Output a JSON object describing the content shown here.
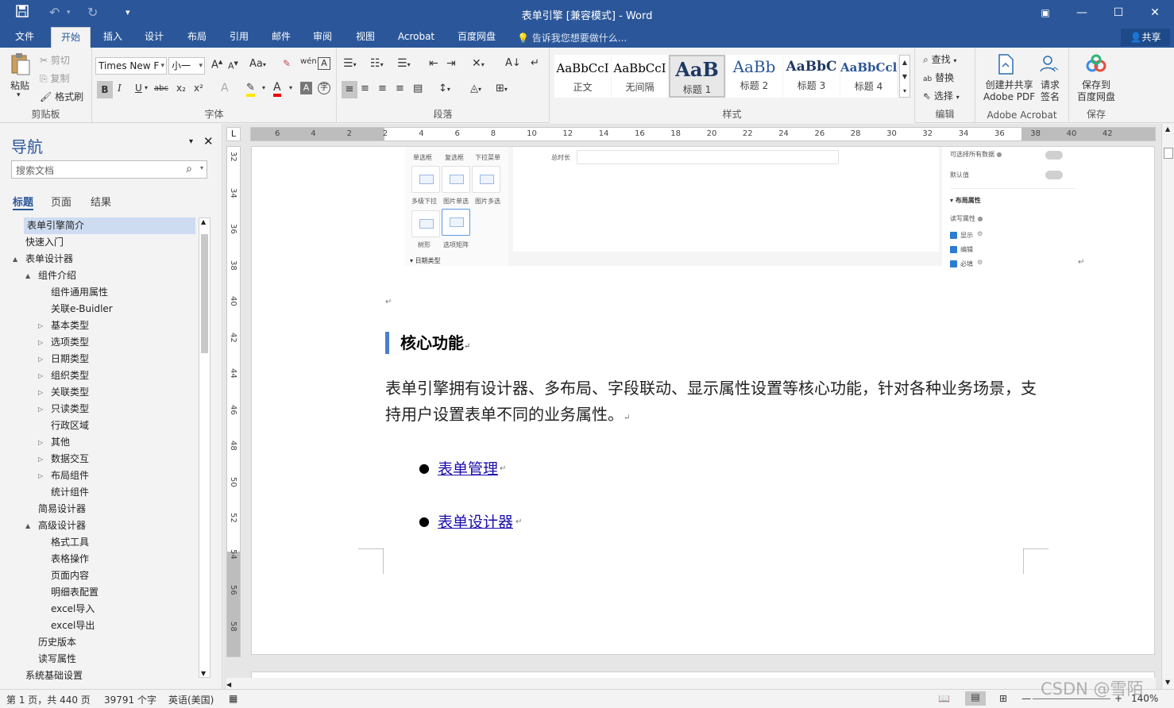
{
  "window": {
    "title": "表单引擎  [兼容模式] - Word"
  },
  "quick_access": {
    "save_icon": "save-icon",
    "undo_icon": "undo-icon",
    "redo_icon": "redo-icon",
    "customize_icon": "customize-icon"
  },
  "tabs": [
    "文件",
    "开始",
    "插入",
    "设计",
    "布局",
    "引用",
    "邮件",
    "审阅",
    "视图",
    "Acrobat",
    "百度网盘"
  ],
  "active_tab": "开始",
  "tell_me": "告诉我您想要做什么...",
  "share": "共享",
  "clipboard": {
    "paste": "粘贴",
    "cut": "剪切",
    "copy": "复制",
    "format_painter": "格式刷",
    "label": "剪贴板"
  },
  "font": {
    "name": "Times New F",
    "size": "小一",
    "label": "字体",
    "case": "Aa",
    "wen": "wén",
    "bold": "B",
    "italic": "I",
    "underline": "U",
    "strike": "abc",
    "sub": "x₂",
    "sup": "x²"
  },
  "paragraph": {
    "label": "段落"
  },
  "styles": {
    "label": "样式",
    "items": [
      {
        "preview": "AaBbCcI",
        "name": "正文"
      },
      {
        "preview": "AaBbCcI",
        "name": "无间隔"
      },
      {
        "preview": "AaB",
        "name": "标题 1"
      },
      {
        "preview": "AaBb",
        "name": "标题 2"
      },
      {
        "preview": "AaBbC",
        "name": "标题 3"
      },
      {
        "preview": "AaBbCcl",
        "name": "标题 4"
      }
    ]
  },
  "editing": {
    "find": "查找",
    "replace": "替换",
    "select": "选择",
    "label": "编辑"
  },
  "acrobat": {
    "create": "创建并共享",
    "create2": "Adobe PDF",
    "request": "请求",
    "request2": "签名",
    "label": "Adobe Acrobat"
  },
  "save_group": {
    "save": "保存到",
    "save2": "百度网盘",
    "label": "保存"
  },
  "nav": {
    "title": "导航",
    "search_placeholder": "搜索文档",
    "tabs": [
      "标题",
      "页面",
      "结果"
    ],
    "items": [
      {
        "label": "表单引擎简介",
        "level": 0,
        "tri": ""
      },
      {
        "label": "快速入门",
        "level": 0,
        "tri": ""
      },
      {
        "label": "表单设计器",
        "level": 0,
        "tri": "▲"
      },
      {
        "label": "组件介绍",
        "level": 1,
        "tri": "▲"
      },
      {
        "label": "组件通用属性",
        "level": 2,
        "tri": ""
      },
      {
        "label": "关联e-Buidler",
        "level": 2,
        "tri": ""
      },
      {
        "label": "基本类型",
        "level": 2,
        "tri": "▷"
      },
      {
        "label": "选项类型",
        "level": 2,
        "tri": "▷"
      },
      {
        "label": "日期类型",
        "level": 2,
        "tri": "▷"
      },
      {
        "label": "组织类型",
        "level": 2,
        "tri": "▷"
      },
      {
        "label": "关联类型",
        "level": 2,
        "tri": "▷"
      },
      {
        "label": "只读类型",
        "level": 2,
        "tri": "▷"
      },
      {
        "label": "行政区域",
        "level": 2,
        "tri": ""
      },
      {
        "label": "其他",
        "level": 2,
        "tri": "▷"
      },
      {
        "label": "数据交互",
        "level": 2,
        "tri": "▷"
      },
      {
        "label": "布局组件",
        "level": 2,
        "tri": "▷"
      },
      {
        "label": "统计组件",
        "level": 2,
        "tri": ""
      },
      {
        "label": "简易设计器",
        "level": 1,
        "tri": ""
      },
      {
        "label": "高级设计器",
        "level": 1,
        "tri": "▲"
      },
      {
        "label": "格式工具",
        "level": 2,
        "tri": ""
      },
      {
        "label": "表格操作",
        "level": 2,
        "tri": ""
      },
      {
        "label": "页面内容",
        "level": 2,
        "tri": ""
      },
      {
        "label": "明细表配置",
        "level": 2,
        "tri": ""
      },
      {
        "label": "excel导入",
        "level": 2,
        "tri": ""
      },
      {
        "label": "excel导出",
        "level": 2,
        "tri": ""
      },
      {
        "label": "历史版本",
        "level": 1,
        "tri": ""
      },
      {
        "label": "读写属性",
        "level": 1,
        "tri": ""
      },
      {
        "label": "系统基础设置",
        "level": 0,
        "tri": ""
      }
    ]
  },
  "ruler": {
    "h_ticks": [
      "6",
      "4",
      "2",
      "2",
      "4",
      "6",
      "8",
      "10",
      "12",
      "14",
      "16",
      "18",
      "20",
      "22",
      "24",
      "26",
      "28",
      "30",
      "32",
      "34",
      "36",
      "38",
      "40",
      "42"
    ],
    "v_ticks": [
      "32",
      "34",
      "36",
      "38",
      "40",
      "42",
      "44",
      "46",
      "48",
      "50",
      "52",
      "54",
      "56",
      "58"
    ]
  },
  "embedded": {
    "comp_labels": [
      "单选框",
      "复选框",
      "下拉菜单",
      "多级下拉",
      "图片单选",
      "图片多选",
      "树形",
      "选项矩阵"
    ],
    "date_type": "日期类型",
    "total_duration": "总时长",
    "select_all": "可选择所有数据",
    "default_value": "默认值",
    "layout_props": "布局属性",
    "rw_props": "读写属性",
    "show": "显示",
    "edit": "编辑",
    "required": "必填"
  },
  "doc": {
    "heading": "核心功能",
    "paragraph": "表单引擎拥有设计器、多布局、字段联动、显示属性设置等核心功能，针对各种业务场景，支持用户设置表单不同的业务属性。",
    "links": [
      "表单管理",
      "表单设计器"
    ]
  },
  "status": {
    "page": "第 1 页，共 440 页",
    "words": "39791 个字",
    "lang": "英语(美国)",
    "zoom": "140%"
  },
  "watermark": "CSDN @雪陌"
}
